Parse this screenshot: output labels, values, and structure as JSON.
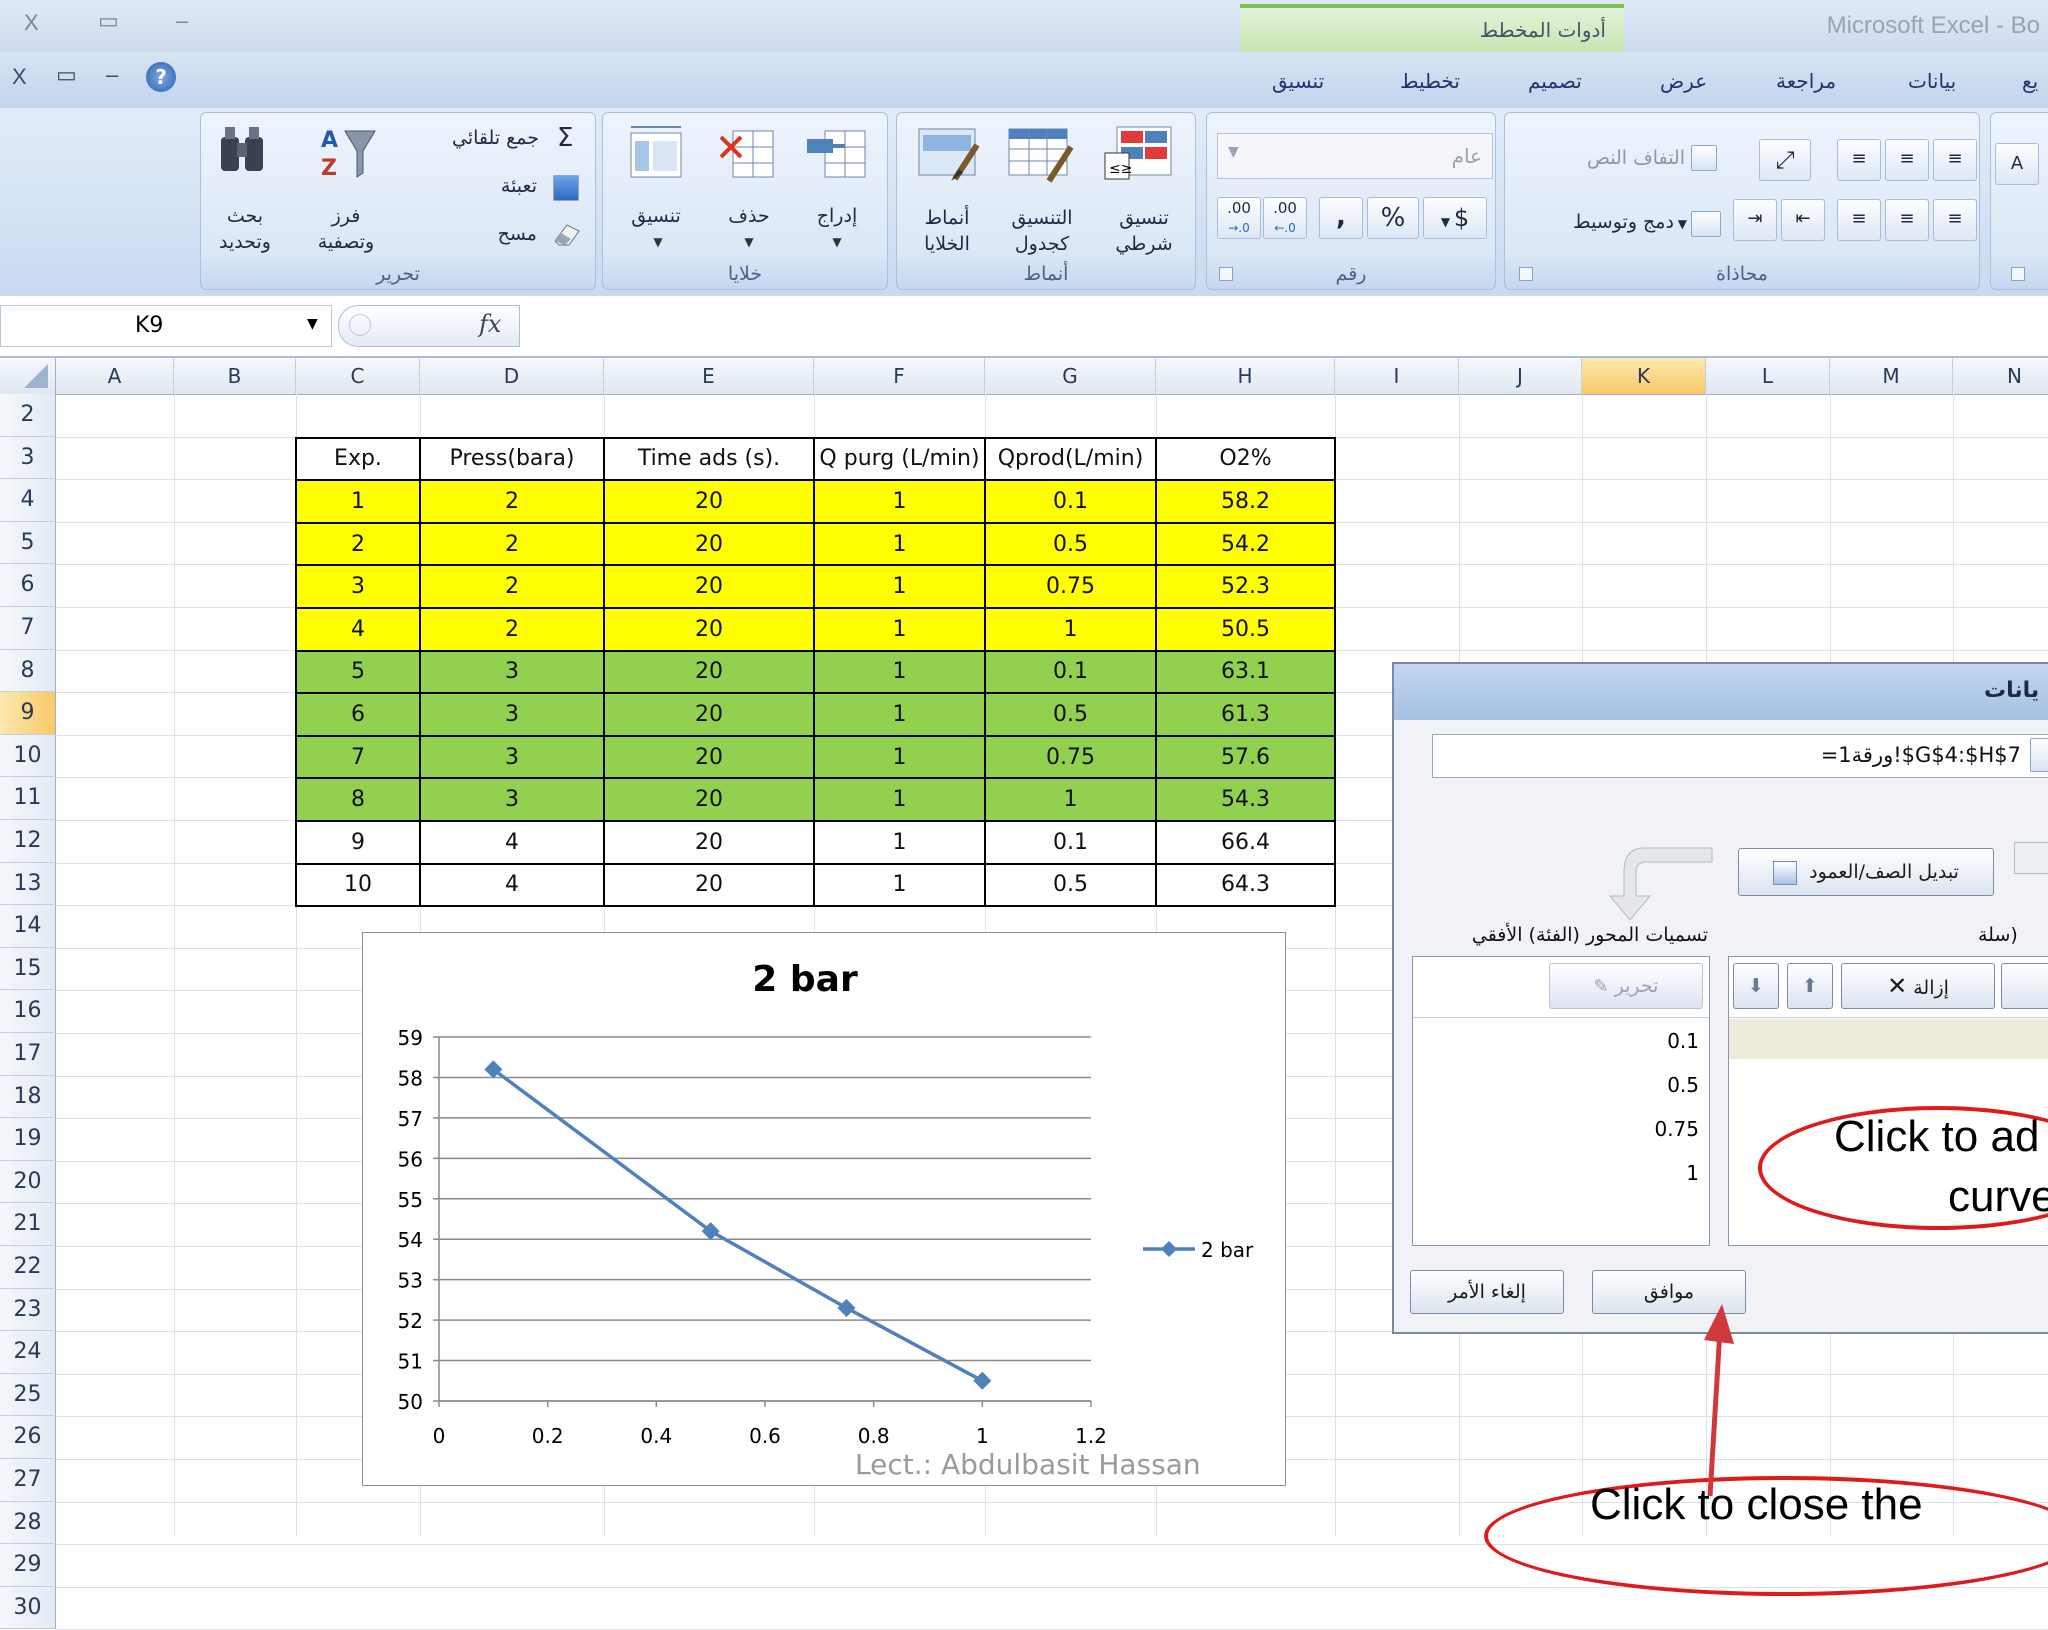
{
  "window": {
    "title": "Microsoft Excel - Bo",
    "chart_tools_label": "أدوات المخطط"
  },
  "window_controls": {
    "close": "X",
    "restore": "▭",
    "minimize": "–",
    "help": "?"
  },
  "tabs": [
    "بيانات",
    "مراجعة",
    "عرض",
    "تصميم",
    "تخطيط",
    "تنسيق"
  ],
  "tab_partial": "يع",
  "ribbon": {
    "editing": {
      "group": "تحرير",
      "autosum": "جمع تلقائي",
      "fill": "تعبئة",
      "clear": "مسح",
      "sort_line1": "فرز",
      "sort_line2": "وتصفية",
      "find_line1": "بحث",
      "find_line2": "وتحديد"
    },
    "cells": {
      "group": "خلايا",
      "insert": "إدراج",
      "delete": "حذف",
      "format": "تنسيق"
    },
    "styles": {
      "group": "أنماط",
      "conditional_line1": "تنسيق",
      "conditional_line2": "شرطي",
      "table_line1": "التنسيق",
      "table_line2": "كجدول",
      "cell_line1": "أنماط",
      "cell_line2": "الخلايا"
    },
    "number": {
      "group": "رقم",
      "format_value": "عام",
      "currency": "$",
      "percent": "%",
      "comma": ",",
      "inc_decimal": ".00",
      "dec_decimal": ".00"
    },
    "alignment": {
      "group": "محاذاة",
      "wrap_text": "التفاف النص",
      "merge_center": "دمج وتوسيط"
    }
  },
  "formula_bar": {
    "name_box": "K9",
    "fx": "fx"
  },
  "columns": [
    {
      "name": "A",
      "w": 118
    },
    {
      "name": "B",
      "w": 122
    },
    {
      "name": "C",
      "w": 124
    },
    {
      "name": "D",
      "w": 184
    },
    {
      "name": "E",
      "w": 210
    },
    {
      "name": "F",
      "w": 171
    },
    {
      "name": "G",
      "w": 171
    },
    {
      "name": "H",
      "w": 179
    },
    {
      "name": "I",
      "w": 124
    },
    {
      "name": "J",
      "w": 123
    },
    {
      "name": "K",
      "w": 124
    },
    {
      "name": "L",
      "w": 124
    },
    {
      "name": "M",
      "w": 123
    },
    {
      "name": "N",
      "w": 124
    }
  ],
  "rows": [
    "2",
    "3",
    "4",
    "5",
    "6",
    "7",
    "8",
    "9",
    "10",
    "11",
    "12",
    "13",
    "14",
    "15",
    "16",
    "17",
    "18",
    "19",
    "20",
    "21",
    "22",
    "23",
    "24",
    "25",
    "26",
    "27",
    "28",
    "29",
    "30"
  ],
  "table": {
    "headers": [
      "Exp.",
      "Press(bara)",
      "Time ads (s).",
      "Q purg (L/min)",
      "Qprod(L/min)",
      "O2%"
    ],
    "rows": [
      [
        "1",
        "2",
        "20",
        "1",
        "0.1",
        "58.2"
      ],
      [
        "2",
        "2",
        "20",
        "1",
        "0.5",
        "54.2"
      ],
      [
        "3",
        "2",
        "20",
        "1",
        "0.75",
        "52.3"
      ],
      [
        "4",
        "2",
        "20",
        "1",
        "1",
        "50.5"
      ],
      [
        "5",
        "3",
        "20",
        "1",
        "0.1",
        "63.1"
      ],
      [
        "6",
        "3",
        "20",
        "1",
        "0.5",
        "61.3"
      ],
      [
        "7",
        "3",
        "20",
        "1",
        "0.75",
        "57.6"
      ],
      [
        "8",
        "3",
        "20",
        "1",
        "1",
        "54.3"
      ],
      [
        "9",
        "4",
        "20",
        "1",
        "0.1",
        "66.4"
      ],
      [
        "10",
        "4",
        "20",
        "1",
        "0.5",
        "64.3"
      ]
    ],
    "row_colors": [
      "#ffff00",
      "#ffff00",
      "#ffff00",
      "#ffff00",
      "#92d050",
      "#92d050",
      "#92d050",
      "#92d050",
      "#ffffff",
      "#ffffff"
    ]
  },
  "chart_data": {
    "type": "line",
    "title": "2 bar",
    "xlabel": "",
    "ylabel": "",
    "xlim": [
      0,
      1.2
    ],
    "ylim": [
      50,
      59
    ],
    "xticks": [
      "0",
      "0.2",
      "0.4",
      "0.6",
      "0.8",
      "1",
      "1.2"
    ],
    "yticks": [
      "50",
      "51",
      "52",
      "53",
      "54",
      "55",
      "56",
      "57",
      "58",
      "59"
    ],
    "grid": true,
    "legend": "right",
    "series": [
      {
        "name": "2 bar",
        "x": [
          0.1,
          0.5,
          0.75,
          1
        ],
        "y": [
          58.2,
          54.2,
          52.3,
          50.5
        ],
        "color": "#4f81bd"
      }
    ]
  },
  "watermark": "Lect.: Abdulbasit Hassan",
  "dialog": {
    "title_partial": "يانات",
    "range": "=ورقة1!$G$4:$H$7",
    "switch_button": "تبديل الصف/العمود",
    "axis_labels_title": "تسميات المحور (الفئة) الأفقي",
    "series_title_partial": "سلة)",
    "edit_button": "تحرير",
    "remove_button": "إزالة",
    "axis_values": [
      "0.1",
      "0.5",
      "0.75",
      "1"
    ],
    "ok": "موافق",
    "cancel": "إلغاء الأمر"
  },
  "annotations": {
    "add_line1": "Click to ad",
    "add_line2": "curve",
    "close_line1": "Click to close the"
  },
  "colors": {
    "accent": "#4f81bd",
    "annotation": "#e0191b",
    "excel_blue": "#21336b"
  }
}
